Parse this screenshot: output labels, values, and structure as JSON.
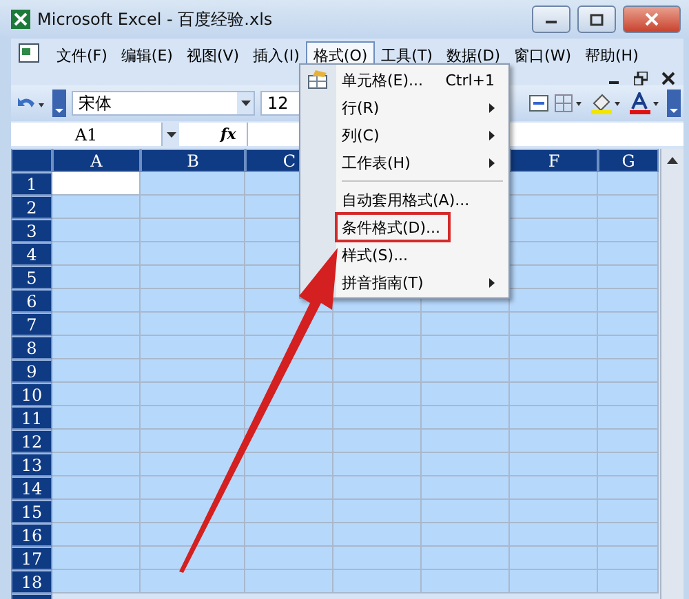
{
  "window": {
    "title": "Microsoft Excel - 百度经验.xls"
  },
  "menu_bar": [
    {
      "label": "文件(F)",
      "selected": false
    },
    {
      "label": "编辑(E)",
      "selected": false
    },
    {
      "label": "视图(V)",
      "selected": false
    },
    {
      "label": "插入(I)",
      "selected": false
    },
    {
      "label": "格式(O)",
      "selected": true
    },
    {
      "label": "工具(T)",
      "selected": false
    },
    {
      "label": "数据(D)",
      "selected": false
    },
    {
      "label": "窗口(W)",
      "selected": false
    },
    {
      "label": "帮助(H)",
      "selected": false
    }
  ],
  "format_menu": [
    {
      "kind": "command",
      "label": "单元格(E)...",
      "shortcut": "Ctrl+1",
      "highlighted": false
    },
    {
      "kind": "submenu",
      "label": "行(R)",
      "highlighted": false
    },
    {
      "kind": "submenu",
      "label": "列(C)",
      "highlighted": false
    },
    {
      "kind": "submenu",
      "label": "工作表(H)",
      "highlighted": false
    },
    {
      "kind": "separator"
    },
    {
      "kind": "command",
      "label": "自动套用格式(A)...",
      "highlighted": false
    },
    {
      "kind": "command",
      "label": "条件格式(D)...",
      "highlighted": true
    },
    {
      "kind": "command",
      "label": "样式(S)...",
      "highlighted": false
    },
    {
      "kind": "submenu",
      "label": "拼音指南(T)",
      "highlighted": false
    }
  ],
  "toolbar": {
    "font": "宋体",
    "font_size": "12"
  },
  "formula_bar": {
    "name_box": "A1",
    "function_label": "fx"
  },
  "sheet": {
    "columns": [
      {
        "label": "A"
      },
      {
        "label": "B"
      },
      {
        "label": "C"
      },
      {},
      {},
      {
        "label": "F"
      },
      {
        "label": "G"
      }
    ],
    "rows": [
      "1",
      "2",
      "3",
      "4",
      "5",
      "6",
      "7",
      "8",
      "9",
      "10",
      "11",
      "12",
      "13",
      "14",
      "15",
      "16",
      "17",
      "18"
    ]
  }
}
